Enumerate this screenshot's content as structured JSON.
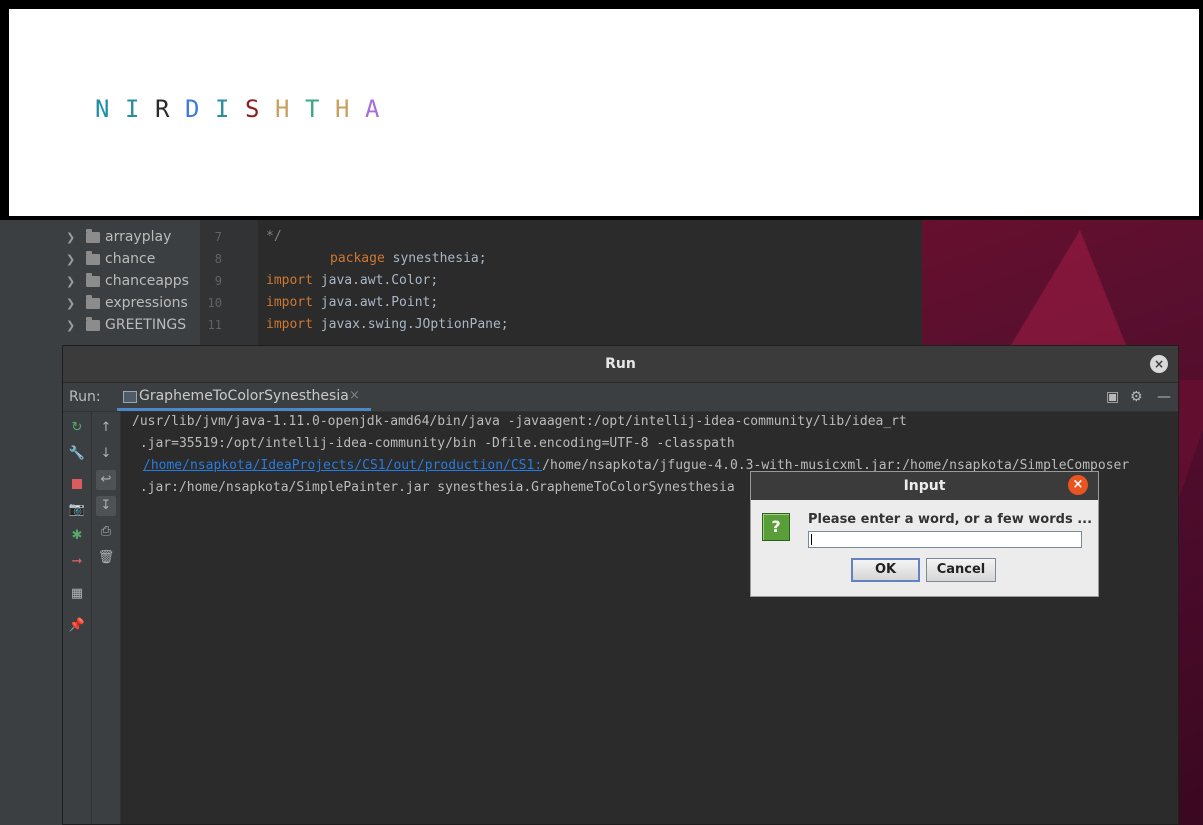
{
  "banner": {
    "letters": [
      {
        "char": "N",
        "color": "#1f8fa8"
      },
      {
        "char": "I",
        "color": "#2a8f9c"
      },
      {
        "char": "R",
        "color": "#2b2b2b"
      },
      {
        "char": "D",
        "color": "#3d7be0"
      },
      {
        "char": "I",
        "color": "#2a8f9c"
      },
      {
        "char": "S",
        "color": "#8a1f1f"
      },
      {
        "char": "H",
        "color": "#c9a05f"
      },
      {
        "char": "T",
        "color": "#3da886"
      },
      {
        "char": "H",
        "color": "#c9a05f"
      },
      {
        "char": "A",
        "color": "#a86cd8"
      }
    ]
  },
  "project_tree": {
    "items": [
      "arrayplay",
      "chance",
      "chanceapps",
      "expressions",
      "GREETINGS"
    ]
  },
  "editor": {
    "lines": [
      {
        "no": "7",
        "text": "*/"
      },
      {
        "no": "8",
        "kw": "package",
        "rest": " synesthesia;"
      },
      {
        "no": "9",
        "kw": "import",
        "rest": " java.awt.Color;"
      },
      {
        "no": "10",
        "kw": "import",
        "rest": " java.awt.Point;"
      },
      {
        "no": "11",
        "kw": "import",
        "rest": " javax.swing.JOptionPane;"
      }
    ]
  },
  "run_window": {
    "title": "Run",
    "run_label": "Run:",
    "tab_label": "GraphemeToColorSynesthesia",
    "console": {
      "line1": "/usr/lib/jvm/java-1.11.0-openjdk-amd64/bin/java -javaagent:/opt/intellij-idea-community/lib/idea_rt",
      "line2": " .jar=35519:/opt/intellij-idea-community/bin -Dfile.encoding=UTF-8 -classpath",
      "line3_link": "/home/nsapkota/IdeaProjects/CS1/out/production/CS1:",
      "line3_rest": "/home/nsapkota/jfugue-4.0.3-with-musicxml.jar:/home/nsapkota/SimpleComposer",
      "line4": " .jar:/home/nsapkota/SimplePainter.jar synesthesia.GraphemeToColorSynesthesia"
    }
  },
  "dialog": {
    "title": "Input",
    "message": "Please enter a word, or a few words ...",
    "input_value": "",
    "ok_label": "OK",
    "cancel_label": "Cancel"
  },
  "icons": {
    "question": "?",
    "close": "×"
  }
}
